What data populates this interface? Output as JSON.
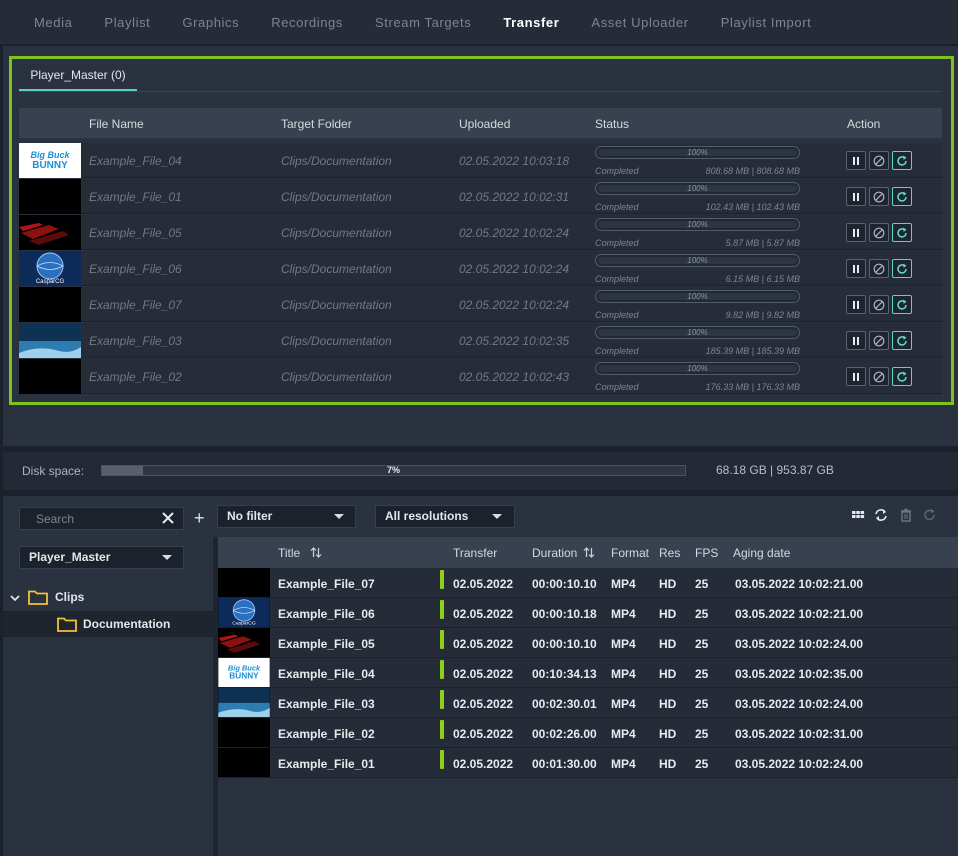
{
  "nav": {
    "tabs": [
      "Media",
      "Playlist",
      "Graphics",
      "Recordings",
      "Stream Targets",
      "Transfer",
      "Asset Uploader",
      "Playlist Import"
    ],
    "active": "Transfer"
  },
  "transfer": {
    "subtab": "Player_Master (0)",
    "columns": {
      "file_name": "File Name",
      "target_folder": "Target Folder",
      "uploaded": "Uploaded",
      "status": "Status",
      "action": "Action"
    },
    "rows": [
      {
        "thumb": "bbb-logo",
        "file": "Example_File_04",
        "folder": "Clips/Documentation",
        "uploaded": "02.05.2022 10:03:18",
        "percent": "100%",
        "progress": 1.0,
        "status": "Completed",
        "size": "808.68 MB | 808.68 MB"
      },
      {
        "thumb": "black",
        "file": "Example_File_01",
        "folder": "Clips/Documentation",
        "uploaded": "02.05.2022 10:02:31",
        "percent": "100%",
        "progress": 1.0,
        "status": "Completed",
        "size": "102.43 MB | 102.43 MB"
      },
      {
        "thumb": "red-streaks",
        "file": "Example_File_05",
        "folder": "Clips/Documentation",
        "uploaded": "02.05.2022 10:02:24",
        "percent": "100%",
        "progress": 1.0,
        "status": "Completed",
        "size": "5.87 MB | 5.87 MB"
      },
      {
        "thumb": "globe",
        "file": "Example_File_06",
        "folder": "Clips/Documentation",
        "uploaded": "02.05.2022 10:02:24",
        "percent": "100%",
        "progress": 1.0,
        "status": "Completed",
        "size": "6.15 MB | 6.15 MB"
      },
      {
        "thumb": "black",
        "file": "Example_File_07",
        "folder": "Clips/Documentation",
        "uploaded": "02.05.2022 10:02:24",
        "percent": "100%",
        "progress": 1.0,
        "status": "Completed",
        "size": "9.82 MB | 9.82 MB"
      },
      {
        "thumb": "sky",
        "file": "Example_File_03",
        "folder": "Clips/Documentation",
        "uploaded": "02.05.2022 10:02:35",
        "percent": "100%",
        "progress": 1.0,
        "status": "Completed",
        "size": "185.39 MB | 185.39 MB"
      },
      {
        "thumb": "black",
        "file": "Example_File_02",
        "folder": "Clips/Documentation",
        "uploaded": "02.05.2022 10:02:43",
        "percent": "100%",
        "progress": 1.0,
        "status": "Completed",
        "size": "176.33 MB | 176.33 MB"
      }
    ]
  },
  "disk": {
    "label": "Disk space:",
    "percent": "7%",
    "fill": 0.07,
    "text": "68.18 GB | 953.87 GB"
  },
  "browser": {
    "search_placeholder": "Search",
    "filter": "No filter",
    "resolution": "All resolutions",
    "player": "Player_Master",
    "tree": {
      "root": "Clips",
      "child": "Documentation"
    },
    "columns": {
      "title": "Title",
      "transfer": "Transfer",
      "duration": "Duration",
      "format": "Format",
      "res": "Res",
      "fps": "FPS",
      "aging": "Aging date"
    },
    "rows": [
      {
        "thumb": "black",
        "title": "Example_File_07",
        "transfer": "02.05.2022",
        "duration": "00:00:10.10",
        "format": "MP4",
        "res": "HD",
        "fps": "25",
        "aging": "03.05.2022 10:02:21.00"
      },
      {
        "thumb": "globe",
        "title": "Example_File_06",
        "transfer": "02.05.2022",
        "duration": "00:00:10.18",
        "format": "MP4",
        "res": "HD",
        "fps": "25",
        "aging": "03.05.2022 10:02:21.00"
      },
      {
        "thumb": "red-streaks",
        "title": "Example_File_05",
        "transfer": "02.05.2022",
        "duration": "00:00:10.10",
        "format": "MP4",
        "res": "HD",
        "fps": "25",
        "aging": "03.05.2022 10:02:24.00"
      },
      {
        "thumb": "bbb-logo",
        "title": "Example_File_04",
        "transfer": "02.05.2022",
        "duration": "00:10:34.13",
        "format": "MP4",
        "res": "HD",
        "fps": "25",
        "aging": "03.05.2022 10:02:35.00"
      },
      {
        "thumb": "sky",
        "title": "Example_File_03",
        "transfer": "02.05.2022",
        "duration": "00:02:30.01",
        "format": "MP4",
        "res": "HD",
        "fps": "25",
        "aging": "03.05.2022 10:02:24.00"
      },
      {
        "thumb": "black",
        "title": "Example_File_02",
        "transfer": "02.05.2022",
        "duration": "00:02:26.00",
        "format": "MP4",
        "res": "HD",
        "fps": "25",
        "aging": "03.05.2022 10:02:31.00"
      },
      {
        "thumb": "black",
        "title": "Example_File_01",
        "transfer": "02.05.2022",
        "duration": "00:01:30.00",
        "format": "MP4",
        "res": "HD",
        "fps": "25",
        "aging": "03.05.2022 10:02:24.00"
      }
    ]
  },
  "thumbnail_text": {
    "bbb_line1": "Big Buck",
    "bbb_line2": "BUNNY",
    "globe_brand": "CasparCG"
  }
}
